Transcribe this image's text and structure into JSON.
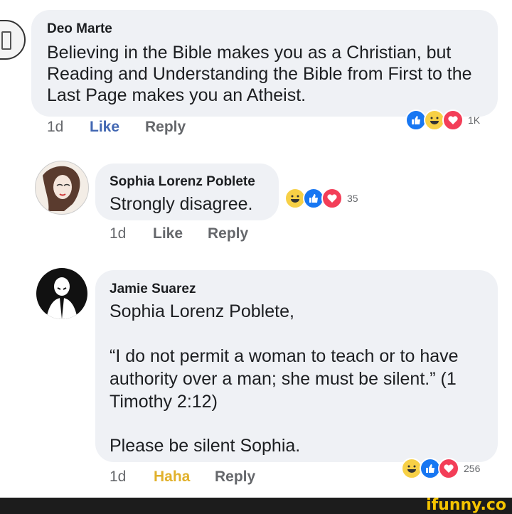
{
  "comments": [
    {
      "author": "Deo Marte",
      "lines": [
        "Believing in the Bible makes you as a Christian, but",
        "Reading and Understanding the Bible from First to the",
        "Last Page makes you an Atheist."
      ],
      "time": "1d",
      "like_label": "Like",
      "reply_label": "Reply",
      "reaction_count": "1K",
      "reactions": [
        "like-icon",
        "haha-icon",
        "love-icon"
      ]
    },
    {
      "author": "Sophia Lorenz Poblete",
      "lines": [
        "Strongly disagree."
      ],
      "time": "1d",
      "like_label": "Like",
      "reply_label": "Reply",
      "reaction_count": "35",
      "reactions": [
        "haha-icon",
        "like-icon",
        "love-icon"
      ]
    },
    {
      "author": "Jamie Suarez",
      "lines": [
        "Sophia Lorenz Poblete,",
        "",
        "“I do not permit a woman to teach or to have",
        "authority over a man; she must be silent.” (1",
        "Timothy 2:12)",
        "",
        "Please be silent Sophia."
      ],
      "time": "1d",
      "like_label": "Haha",
      "reply_label": "Reply",
      "reaction_count": "256",
      "reactions": [
        "haha-icon",
        "like-icon",
        "love-icon"
      ]
    }
  ],
  "watermark": "ifunny.co",
  "colors": {
    "bubble": "#eff1f5",
    "like_blue": "#4267b2",
    "haha_yellow": "#e1b12c",
    "meta_gray": "#65676b"
  }
}
